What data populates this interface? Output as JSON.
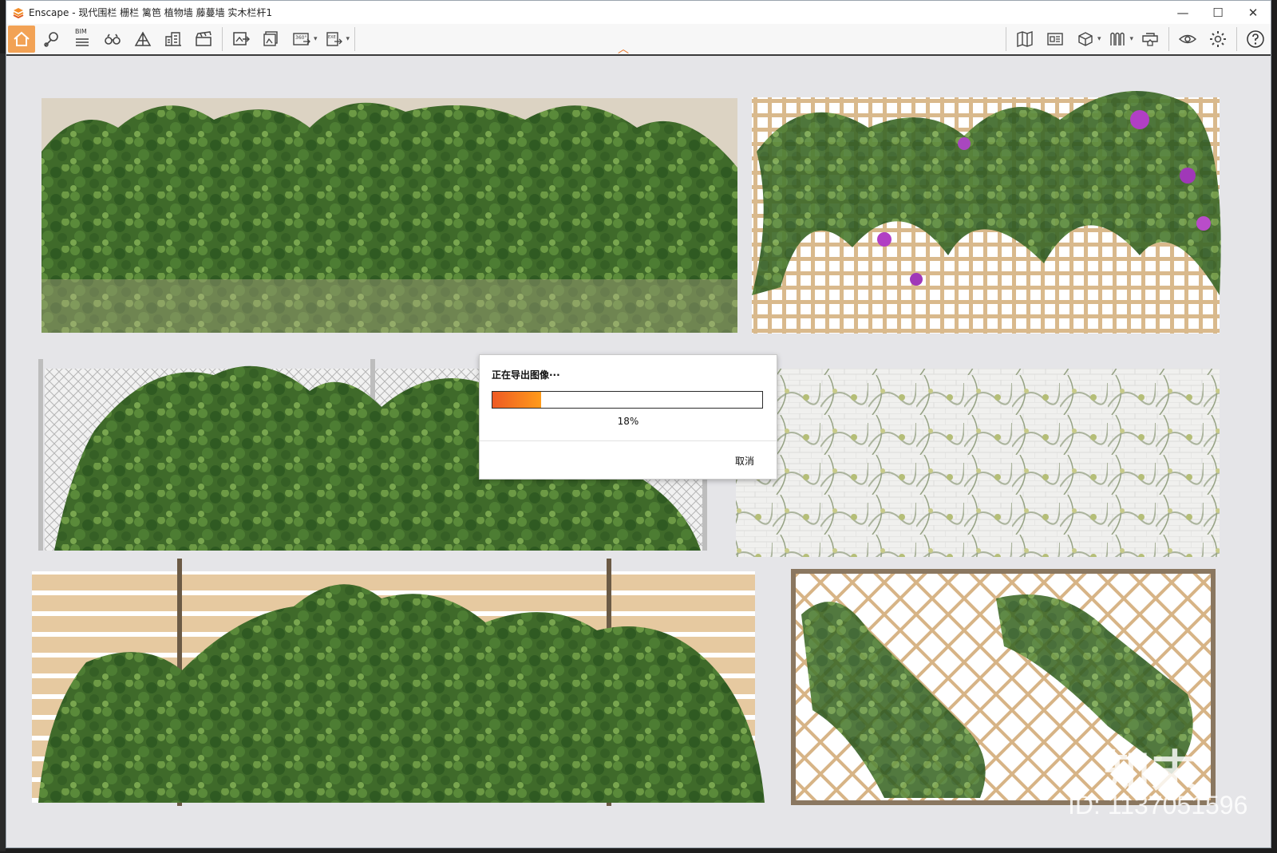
{
  "window": {
    "app_name": "Enscape",
    "title_separator": " - ",
    "document": "现代围栏 栅栏 篱笆 植物墙 藤蔓墙 实木栏杆1",
    "controls": {
      "minimize": "—",
      "maximize": "☐",
      "close": "✕"
    }
  },
  "toolbar": {
    "bim_label": "BIM",
    "left_tools": [
      "home-icon",
      "visual-settings-pin-icon",
      "bim-list-icon",
      "binoculars-icon",
      "mountain-icon",
      "buildings-icon",
      "clapperboard-icon"
    ],
    "export_tools": [
      "screenshot-export-icon",
      "batch-export-icon",
      "panorama-360-icon",
      "exe-export-icon"
    ],
    "right_tools": [
      "map-icon",
      "asset-library-icon",
      "cube-view-icon",
      "material-icon",
      "vr-headset-icon",
      "eye-icon",
      "settings-icon",
      "help-icon"
    ],
    "accent_color": "#f2a255"
  },
  "dialog": {
    "title": "正在导出图像···",
    "progress_percent": 18,
    "progress_label": "18%",
    "cancel_label": "取消"
  },
  "watermark": {
    "logo_text": "知末",
    "id_text": "ID: 1137051596"
  }
}
